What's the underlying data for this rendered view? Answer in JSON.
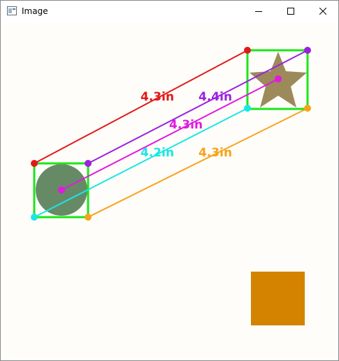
{
  "window": {
    "title": "Image",
    "icon": "image-window-icon",
    "controls": [
      "minimize-icon",
      "maximize-icon",
      "close-icon"
    ]
  },
  "colors": {
    "box": "#19e619",
    "red": "#e01a1a",
    "purple": "#9a21e0",
    "magenta": "#e01ae0",
    "cyan": "#1ae6e6",
    "orange": "#f5a31a",
    "circle_fill": "#668a66",
    "star_fill": "#9c8a5a",
    "square_fill": "#d48300"
  },
  "measurements": [
    {
      "id": "red",
      "label": "4.3in"
    },
    {
      "id": "purple",
      "label": "4.4in"
    },
    {
      "id": "magenta",
      "label": "4.3in"
    },
    {
      "id": "cyan",
      "label": "4.2in"
    },
    {
      "id": "orange",
      "label": "4.3in"
    }
  ]
}
